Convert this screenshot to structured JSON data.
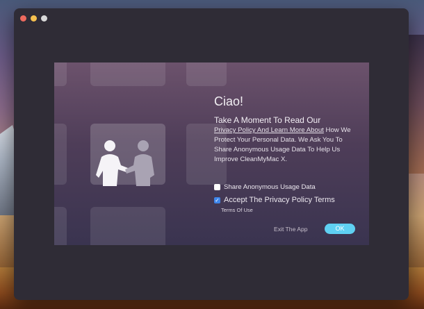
{
  "window": {
    "traffic_lights": [
      "close",
      "minimize",
      "zoom"
    ]
  },
  "onboarding": {
    "heading": "Ciao!",
    "lead": "Take A Moment To Read Our",
    "privacy_link": "Privacy Policy And Learn More About",
    "body": "How We Protect Your Personal Data. We Ask You To Share Anonymous Usage Data To Help Us Improve CleanMyMac X.",
    "share_usage": {
      "label": "Share Anonymous Usage Data",
      "checked": false
    },
    "accept_terms": {
      "label": "Accept The Privacy Policy Terms",
      "checked": true
    },
    "terms_link": "Terms Of Use",
    "exit_label": "Exit The App",
    "ok_label": "OK"
  },
  "colors": {
    "accent_checkbox": "#3e86ea",
    "ok_button": "#5fd0f2",
    "panel_top": "#6c526c",
    "panel_bottom": "#3a3450",
    "window_bg": "#2f2c36"
  },
  "icons": [
    "handshake-icon",
    "check-icon"
  ]
}
